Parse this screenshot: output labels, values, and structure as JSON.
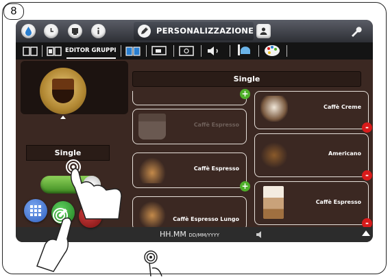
{
  "step_number": "8",
  "topbar": {
    "active_section": "PERSONALIZZAZIONE"
  },
  "subtabs": {
    "active_tab": "EDITOR GRUPPI"
  },
  "left_panel": {
    "selected_name": "Single"
  },
  "group": {
    "title": "Single"
  },
  "drinks_left": [
    {
      "name": "Caffè Espresso",
      "enabled": false,
      "badge": "+"
    },
    {
      "name": "Caffè Espresso",
      "enabled": true,
      "badge": "+"
    },
    {
      "name": "Caffè Espresso Lungo",
      "enabled": true,
      "badge": ""
    }
  ],
  "drinks_right": [
    {
      "name": "Caffè Creme",
      "enabled": true,
      "badge": "-"
    },
    {
      "name": "Americano",
      "enabled": true,
      "badge": "-"
    },
    {
      "name": "Caffè Espresso",
      "enabled": true,
      "badge": "-"
    }
  ],
  "statusbar": {
    "time": "HH.MM",
    "date": "DD/MM/YYYY"
  },
  "toggle": {
    "state": "on"
  },
  "colors": {
    "accent_green": "#4fb02a",
    "remove_red": "#d81b1b",
    "background_brown": "#3b2822"
  }
}
